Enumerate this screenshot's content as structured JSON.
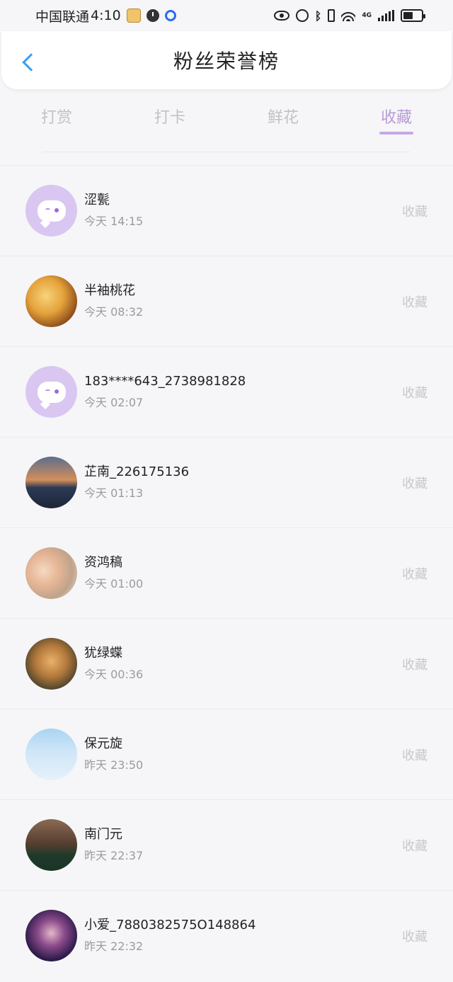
{
  "status_bar": {
    "carrier": "中国联通",
    "time": "4:10",
    "network": "4G"
  },
  "header": {
    "title": "粉丝荣誉榜"
  },
  "tabs": [
    {
      "label": "打赏",
      "active": false
    },
    {
      "label": "打卡",
      "active": false
    },
    {
      "label": "鲜花",
      "active": false
    },
    {
      "label": "收藏",
      "active": true
    }
  ],
  "fans": [
    {
      "name": "涩甏",
      "time": "今天 14:15",
      "action": "收藏",
      "avatar": "default-avatar"
    },
    {
      "name": "半袖桃花",
      "time": "今天 08:32",
      "action": "收藏",
      "avatar": "photo-avatar"
    },
    {
      "name": "183****643_2738981828",
      "time": "今天 02:07",
      "action": "收藏",
      "avatar": "default-avatar"
    },
    {
      "name": "芷南_226175136",
      "time": "今天 01:13",
      "action": "收藏",
      "avatar": "photo-avatar"
    },
    {
      "name": "资鸿稿",
      "time": "今天 01:00",
      "action": "收藏",
      "avatar": "photo-avatar"
    },
    {
      "name": "犹绿蝶",
      "time": "今天 00:36",
      "action": "收藏",
      "avatar": "photo-avatar"
    },
    {
      "name": "保元旋",
      "time": "昨天 23:50",
      "action": "收藏",
      "avatar": "photo-avatar"
    },
    {
      "name": "南门元",
      "time": "昨天 22:37",
      "action": "收藏",
      "avatar": "photo-avatar"
    },
    {
      "name": "小爱_7880382575O148864",
      "time": "昨天 22:32",
      "action": "收藏",
      "avatar": "photo-avatar"
    }
  ],
  "colors": {
    "accent": "#b99bd8",
    "back_icon": "#3b9cf5",
    "inactive_tab": "#c2c2c6"
  }
}
